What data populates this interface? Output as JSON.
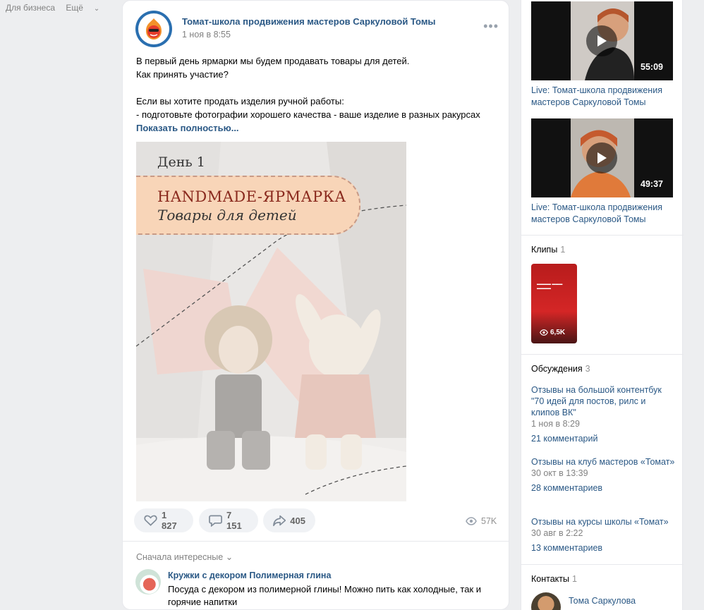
{
  "top_links": {
    "business": "Для бизнеса",
    "more": "Ещё"
  },
  "post": {
    "author": "Томат-школа продвижения мастеров Саркуловой Томы",
    "date": "1 ноя в 8:55",
    "text_lines": [
      "В первый день ярмарки мы будем продавать товары для детей.",
      "Как принять участие?",
      "",
      "Если вы хотите продать изделия ручной работы:",
      "- подготовьте фотографии хорошего качества - ваше изделие в разных ракурсах"
    ],
    "show_more": "Показать полностью...",
    "image": {
      "day": "День 1",
      "heading": "HANDMADE-ЯРМАРКА",
      "subheading": "Товары для детей"
    },
    "likes": "1 827",
    "comments": "7 151",
    "shares": "405",
    "views": "57K",
    "sort_label": "Сначала интересные",
    "comment": {
      "author": "Кружки с декором Полимерная глина",
      "text": "Посуда с декором из полимерной глины! Можно пить как холодные, так и горячие напитки"
    }
  },
  "sidebar": {
    "videos": [
      {
        "duration": "55:09",
        "title": "Live: Томат-школа продвижения мастеров Саркуловой Томы"
      },
      {
        "duration": "49:37",
        "title": "Live: Томат-школа продвижения мастеров Саркуловой Томы"
      }
    ],
    "clips": {
      "label": "Клипы",
      "count": "1",
      "views": "6,5K"
    },
    "discussions": {
      "label": "Обсуждения",
      "count": "3",
      "items": [
        {
          "title": "Отзывы на большой контентбук \"70 идей для постов, рилс и клипов ВК\"",
          "date": "1 ноя в 8:29",
          "comments": "21 комментарий"
        },
        {
          "title": "Отзывы на клуб мастеров «Томат»",
          "date": "30 окт в 13:39",
          "comments": "28 комментариев"
        },
        {
          "title": "Отзывы на курсы школы «Томат»",
          "date": "30 авг в 2:22",
          "comments": "13 комментариев"
        }
      ]
    },
    "contacts": {
      "label": "Контакты",
      "count": "1",
      "name": "Тома Саркулова"
    }
  },
  "colors": {
    "link": "#2a5885",
    "background": "#edeef0",
    "muted": "#828282"
  }
}
